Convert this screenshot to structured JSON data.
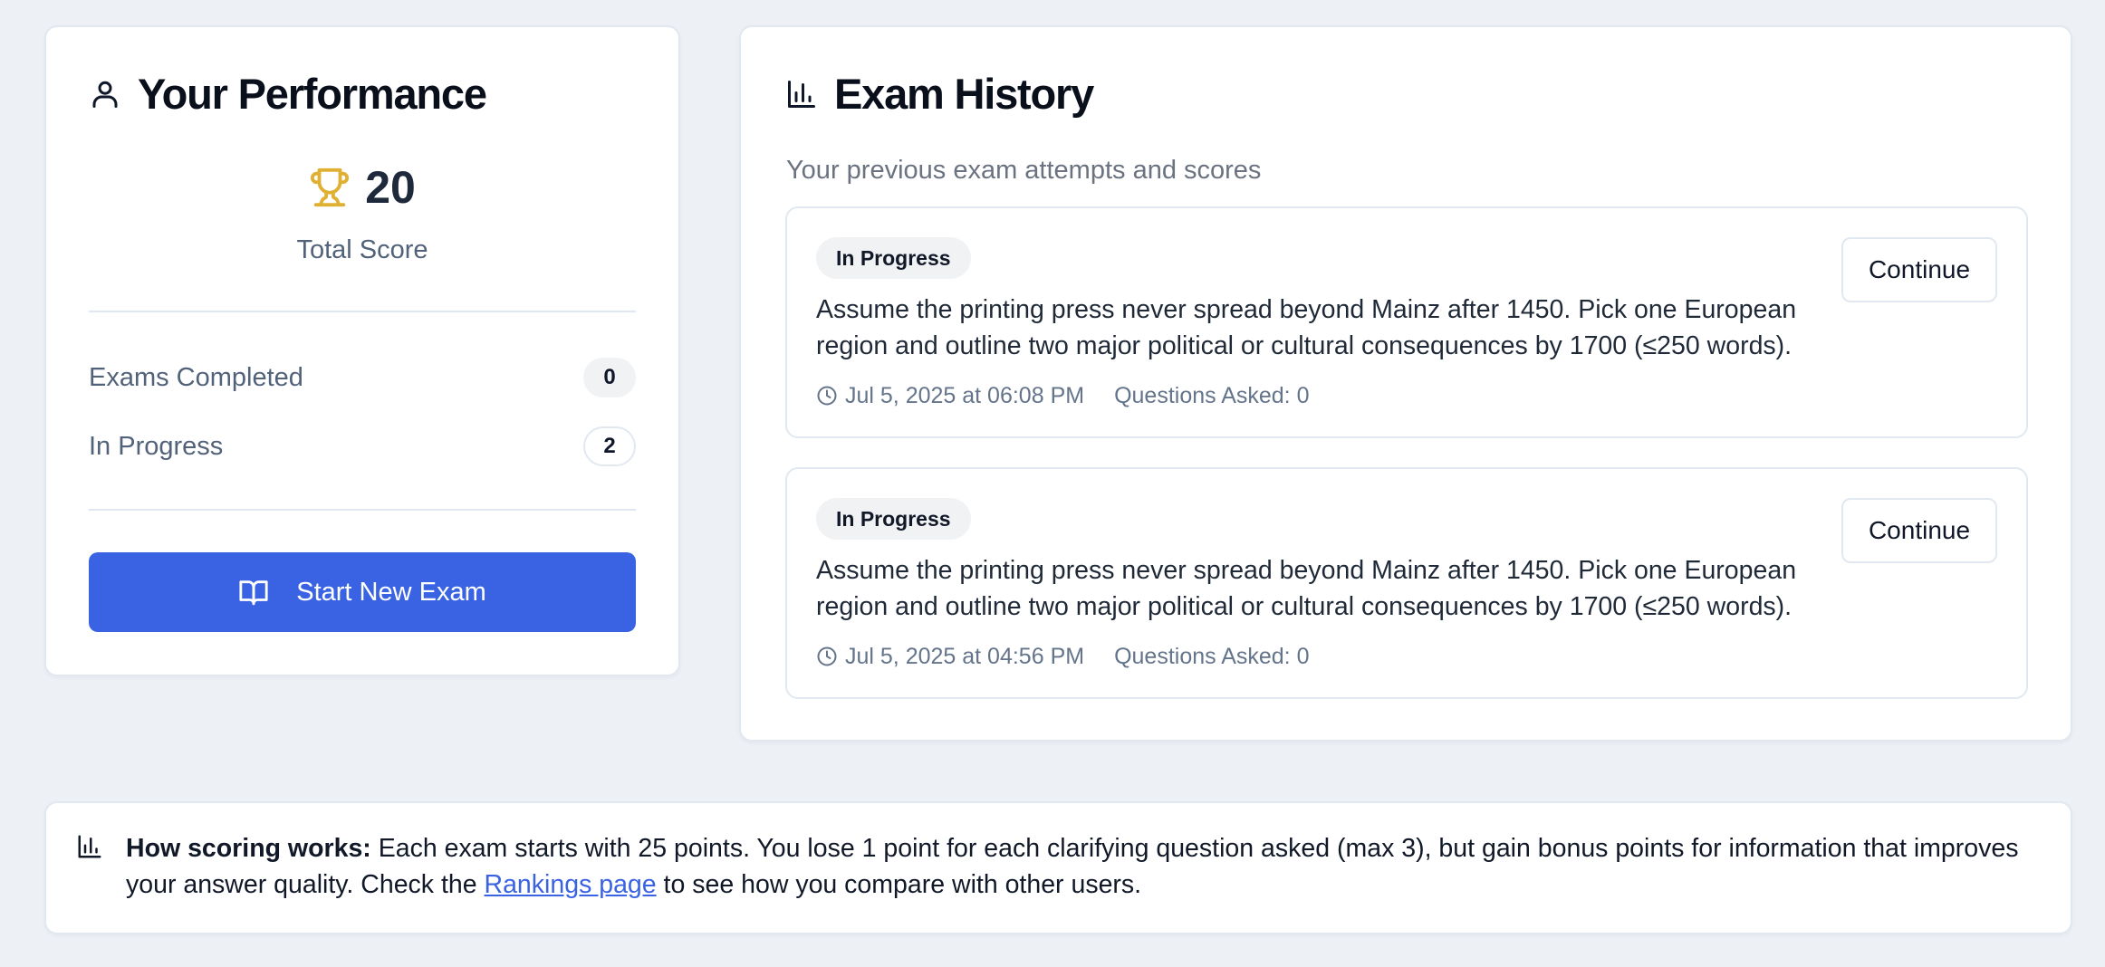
{
  "performance": {
    "title": "Your Performance",
    "total_score": "20",
    "total_score_label": "Total Score",
    "stats": [
      {
        "label": "Exams Completed",
        "value": "0"
      },
      {
        "label": "In Progress",
        "value": "2"
      }
    ],
    "start_button_label": "Start New Exam",
    "trophy_color": "#e0b033",
    "button_color": "#3a63e3"
  },
  "history": {
    "title": "Exam History",
    "subtitle": "Your previous exam attempts and scores",
    "exams": [
      {
        "status": "In Progress",
        "prompt": "Assume the printing press never spread beyond Mainz after 1450. Pick one European region and outline two major political or cultural consequences by 1700 (≤250 words).",
        "date": "Jul 5, 2025 at 06:08 PM",
        "questions": "Questions Asked: 0",
        "action_label": "Continue"
      },
      {
        "status": "In Progress",
        "prompt": "Assume the printing press never spread beyond Mainz after 1450. Pick one European region and outline two major political or cultural consequences by 1700 (≤250 words).",
        "date": "Jul 5, 2025 at 04:56 PM",
        "questions": "Questions Asked: 0",
        "action_label": "Continue"
      }
    ]
  },
  "info": {
    "heading": "How scoring works:",
    "text_before_link": " Each exam starts with 25 points. You lose 1 point for each clarifying question asked (max 3), but gain bonus points for information that improves your answer quality. Check the ",
    "link_text": "Rankings page",
    "text_after_link": " to see how you compare with other users."
  },
  "icons": {
    "title_performance": "user-icon",
    "score": "trophy-icon",
    "start": "book-open-icon",
    "title_history": "bar-chart-icon",
    "exam_date": "clock-icon",
    "info": "bar-chart-icon"
  }
}
